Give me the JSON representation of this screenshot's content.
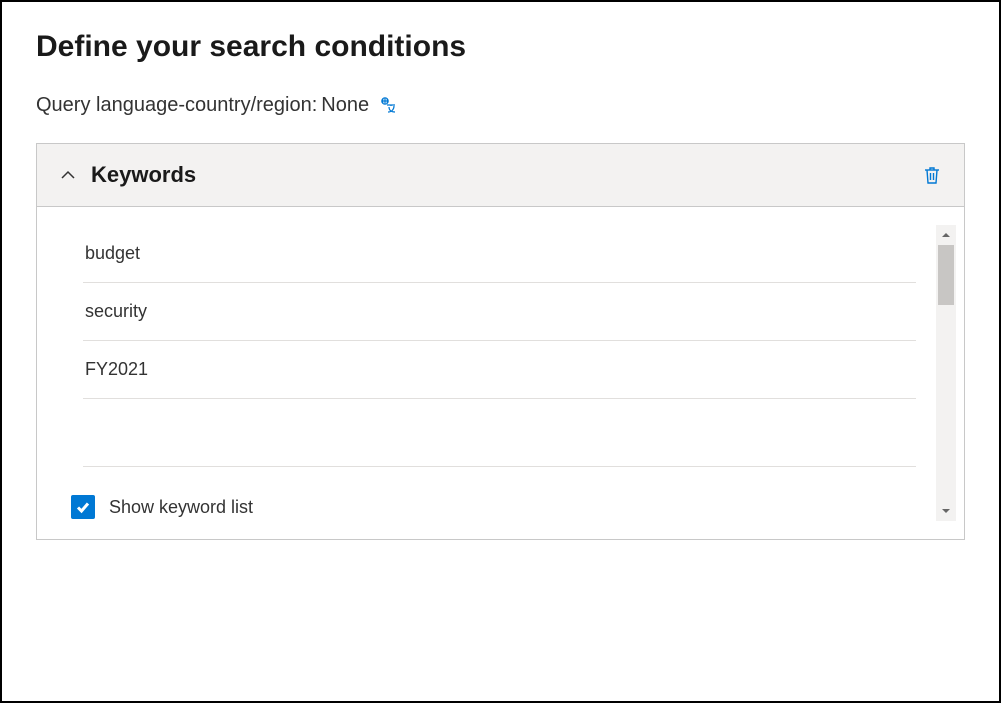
{
  "page": {
    "title": "Define your search conditions"
  },
  "query_language": {
    "label": "Query language-country/region:",
    "value": "None"
  },
  "keywords": {
    "panel_title": "Keywords",
    "items": [
      "budget",
      "security",
      "FY2021"
    ]
  },
  "show_keyword_list": {
    "label": "Show keyword list",
    "checked": true
  },
  "colors": {
    "accent": "#0078d4"
  }
}
